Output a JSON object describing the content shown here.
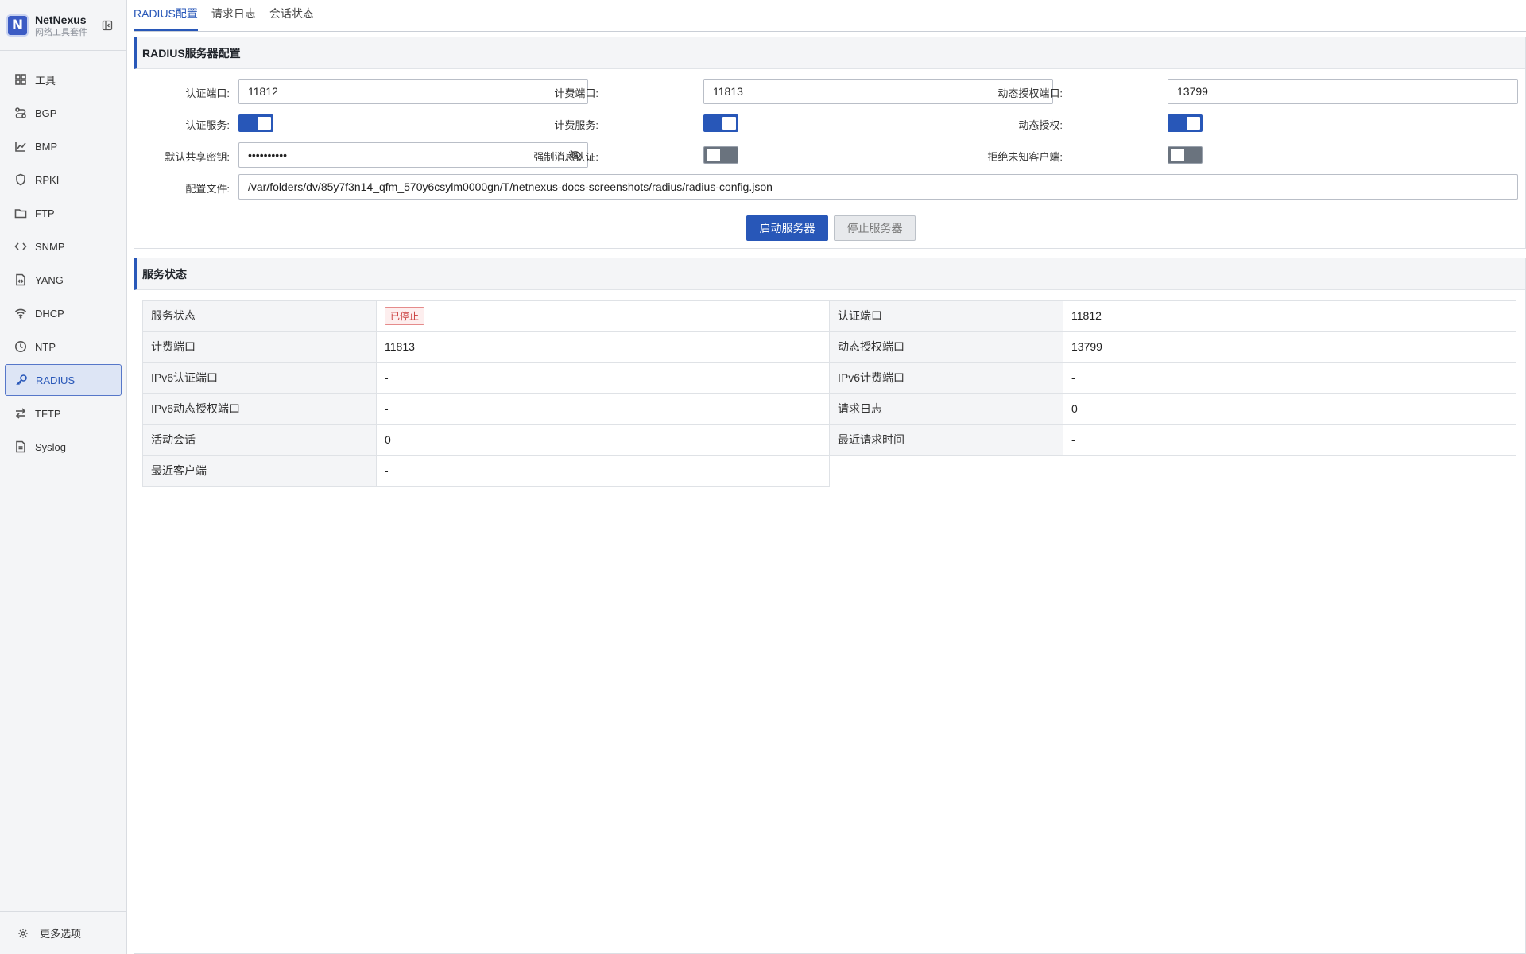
{
  "app": {
    "name": "NetNexus",
    "subtitle": "网络工具套件",
    "logo_letter": "N"
  },
  "sidebar": {
    "items": [
      {
        "label": "工具",
        "icon": "grid-icon"
      },
      {
        "label": "BGP",
        "icon": "route-icon"
      },
      {
        "label": "BMP",
        "icon": "chart-icon"
      },
      {
        "label": "RPKI",
        "icon": "shield-icon"
      },
      {
        "label": "FTP",
        "icon": "folder-icon"
      },
      {
        "label": "SNMP",
        "icon": "code-icon"
      },
      {
        "label": "YANG",
        "icon": "file-code-icon"
      },
      {
        "label": "DHCP",
        "icon": "wifi-icon"
      },
      {
        "label": "NTP",
        "icon": "clock-icon"
      },
      {
        "label": "RADIUS",
        "icon": "key-icon",
        "active": true
      },
      {
        "label": "TFTP",
        "icon": "transfer-icon"
      },
      {
        "label": "Syslog",
        "icon": "document-icon"
      }
    ],
    "more_label": "更多选项"
  },
  "tabs": [
    {
      "label": "RADIUS配置",
      "active": true
    },
    {
      "label": "请求日志"
    },
    {
      "label": "会话状态"
    }
  ],
  "config": {
    "title": "RADIUS服务器配置",
    "auth_port_label": "认证端口:",
    "auth_port_value": "11812",
    "acct_port_label": "计费端口:",
    "acct_port_value": "11813",
    "coa_port_label": "动态授权端口:",
    "coa_port_value": "13799",
    "auth_service_label": "认证服务:",
    "auth_service_on": true,
    "acct_service_label": "计费服务:",
    "acct_service_on": true,
    "coa_label": "动态授权:",
    "coa_on": true,
    "secret_label": "默认共享密钥:",
    "secret_value": "••••••••••",
    "force_msg_auth_label": "强制消息认证:",
    "force_msg_auth_on": false,
    "reject_unknown_label": "拒绝未知客户端:",
    "reject_unknown_on": false,
    "config_file_label": "配置文件:",
    "config_file_value": "/var/folders/dv/85y7f3n14_qfm_570y6csylm0000gn/T/netnexus-docs-screenshots/radius/radius-config.json",
    "start_button": "启动服务器",
    "stop_button": "停止服务器"
  },
  "status": {
    "title": "服务状态",
    "rows": [
      {
        "k1": "服务状态",
        "v1": "已停止",
        "k2": "认证端口",
        "v2": "11812"
      },
      {
        "k1": "计费端口",
        "v1": "11813",
        "k2": "动态授权端口",
        "v2": "13799"
      },
      {
        "k1": "IPv6认证端口",
        "v1": "-",
        "k2": "IPv6计费端口",
        "v2": "-"
      },
      {
        "k1": "IPv6动态授权端口",
        "v1": "-",
        "k2": "请求日志",
        "v2": "0"
      },
      {
        "k1": "活动会话",
        "v1": "0",
        "k2": "最近请求时间",
        "v2": "-"
      },
      {
        "k1": "最近客户端",
        "v1": "-"
      }
    ]
  },
  "colors": {
    "accent": "#2857b8",
    "stopped_badge": "#c93a3a"
  }
}
